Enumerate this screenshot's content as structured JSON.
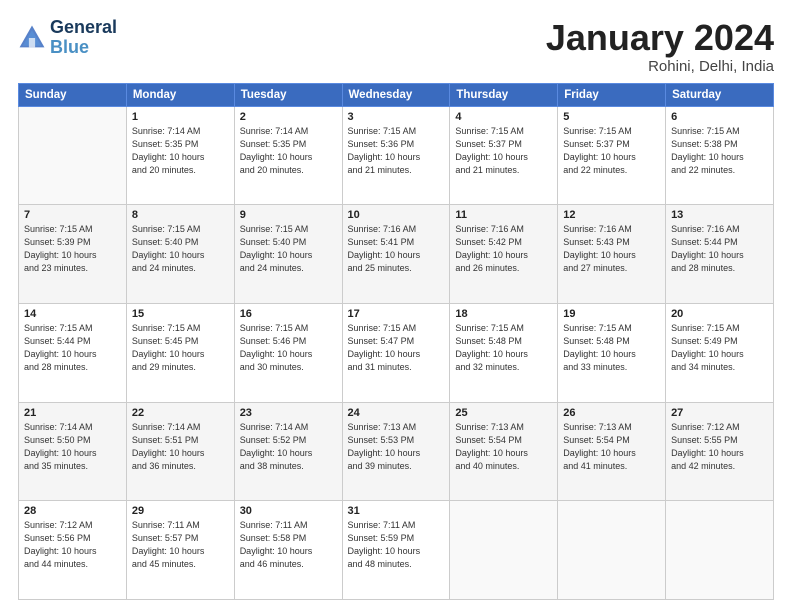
{
  "logo": {
    "line1": "General",
    "line2": "Blue"
  },
  "title": "January 2024",
  "location": "Rohini, Delhi, India",
  "days_header": [
    "Sunday",
    "Monday",
    "Tuesday",
    "Wednesday",
    "Thursday",
    "Friday",
    "Saturday"
  ],
  "weeks": [
    [
      {
        "day": "",
        "info": ""
      },
      {
        "day": "1",
        "info": "Sunrise: 7:14 AM\nSunset: 5:35 PM\nDaylight: 10 hours\nand 20 minutes."
      },
      {
        "day": "2",
        "info": "Sunrise: 7:14 AM\nSunset: 5:35 PM\nDaylight: 10 hours\nand 20 minutes."
      },
      {
        "day": "3",
        "info": "Sunrise: 7:15 AM\nSunset: 5:36 PM\nDaylight: 10 hours\nand 21 minutes."
      },
      {
        "day": "4",
        "info": "Sunrise: 7:15 AM\nSunset: 5:37 PM\nDaylight: 10 hours\nand 21 minutes."
      },
      {
        "day": "5",
        "info": "Sunrise: 7:15 AM\nSunset: 5:37 PM\nDaylight: 10 hours\nand 22 minutes."
      },
      {
        "day": "6",
        "info": "Sunrise: 7:15 AM\nSunset: 5:38 PM\nDaylight: 10 hours\nand 22 minutes."
      }
    ],
    [
      {
        "day": "7",
        "info": "Sunrise: 7:15 AM\nSunset: 5:39 PM\nDaylight: 10 hours\nand 23 minutes."
      },
      {
        "day": "8",
        "info": "Sunrise: 7:15 AM\nSunset: 5:40 PM\nDaylight: 10 hours\nand 24 minutes."
      },
      {
        "day": "9",
        "info": "Sunrise: 7:15 AM\nSunset: 5:40 PM\nDaylight: 10 hours\nand 24 minutes."
      },
      {
        "day": "10",
        "info": "Sunrise: 7:16 AM\nSunset: 5:41 PM\nDaylight: 10 hours\nand 25 minutes."
      },
      {
        "day": "11",
        "info": "Sunrise: 7:16 AM\nSunset: 5:42 PM\nDaylight: 10 hours\nand 26 minutes."
      },
      {
        "day": "12",
        "info": "Sunrise: 7:16 AM\nSunset: 5:43 PM\nDaylight: 10 hours\nand 27 minutes."
      },
      {
        "day": "13",
        "info": "Sunrise: 7:16 AM\nSunset: 5:44 PM\nDaylight: 10 hours\nand 28 minutes."
      }
    ],
    [
      {
        "day": "14",
        "info": "Sunrise: 7:15 AM\nSunset: 5:44 PM\nDaylight: 10 hours\nand 28 minutes."
      },
      {
        "day": "15",
        "info": "Sunrise: 7:15 AM\nSunset: 5:45 PM\nDaylight: 10 hours\nand 29 minutes."
      },
      {
        "day": "16",
        "info": "Sunrise: 7:15 AM\nSunset: 5:46 PM\nDaylight: 10 hours\nand 30 minutes."
      },
      {
        "day": "17",
        "info": "Sunrise: 7:15 AM\nSunset: 5:47 PM\nDaylight: 10 hours\nand 31 minutes."
      },
      {
        "day": "18",
        "info": "Sunrise: 7:15 AM\nSunset: 5:48 PM\nDaylight: 10 hours\nand 32 minutes."
      },
      {
        "day": "19",
        "info": "Sunrise: 7:15 AM\nSunset: 5:48 PM\nDaylight: 10 hours\nand 33 minutes."
      },
      {
        "day": "20",
        "info": "Sunrise: 7:15 AM\nSunset: 5:49 PM\nDaylight: 10 hours\nand 34 minutes."
      }
    ],
    [
      {
        "day": "21",
        "info": "Sunrise: 7:14 AM\nSunset: 5:50 PM\nDaylight: 10 hours\nand 35 minutes."
      },
      {
        "day": "22",
        "info": "Sunrise: 7:14 AM\nSunset: 5:51 PM\nDaylight: 10 hours\nand 36 minutes."
      },
      {
        "day": "23",
        "info": "Sunrise: 7:14 AM\nSunset: 5:52 PM\nDaylight: 10 hours\nand 38 minutes."
      },
      {
        "day": "24",
        "info": "Sunrise: 7:13 AM\nSunset: 5:53 PM\nDaylight: 10 hours\nand 39 minutes."
      },
      {
        "day": "25",
        "info": "Sunrise: 7:13 AM\nSunset: 5:54 PM\nDaylight: 10 hours\nand 40 minutes."
      },
      {
        "day": "26",
        "info": "Sunrise: 7:13 AM\nSunset: 5:54 PM\nDaylight: 10 hours\nand 41 minutes."
      },
      {
        "day": "27",
        "info": "Sunrise: 7:12 AM\nSunset: 5:55 PM\nDaylight: 10 hours\nand 42 minutes."
      }
    ],
    [
      {
        "day": "28",
        "info": "Sunrise: 7:12 AM\nSunset: 5:56 PM\nDaylight: 10 hours\nand 44 minutes."
      },
      {
        "day": "29",
        "info": "Sunrise: 7:11 AM\nSunset: 5:57 PM\nDaylight: 10 hours\nand 45 minutes."
      },
      {
        "day": "30",
        "info": "Sunrise: 7:11 AM\nSunset: 5:58 PM\nDaylight: 10 hours\nand 46 minutes."
      },
      {
        "day": "31",
        "info": "Sunrise: 7:11 AM\nSunset: 5:59 PM\nDaylight: 10 hours\nand 48 minutes."
      },
      {
        "day": "",
        "info": ""
      },
      {
        "day": "",
        "info": ""
      },
      {
        "day": "",
        "info": ""
      }
    ]
  ]
}
